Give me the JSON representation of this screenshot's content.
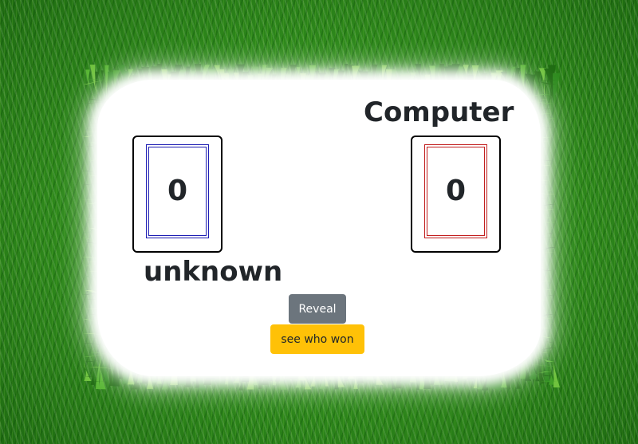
{
  "background": {
    "grass_color": "#2f8a1c",
    "field_color": "#ffffff"
  },
  "players": {
    "computer_name": "Computer",
    "player_name": "unknown"
  },
  "cards": {
    "player_value": "0",
    "player_border_color": "#1d1db3",
    "computer_value": "0",
    "computer_border_color": "#c21f1f"
  },
  "buttons": {
    "reveal_label": "Reveal",
    "reveal_color": "#6c757d",
    "won_label": "see who won",
    "won_color": "#ffc107"
  }
}
